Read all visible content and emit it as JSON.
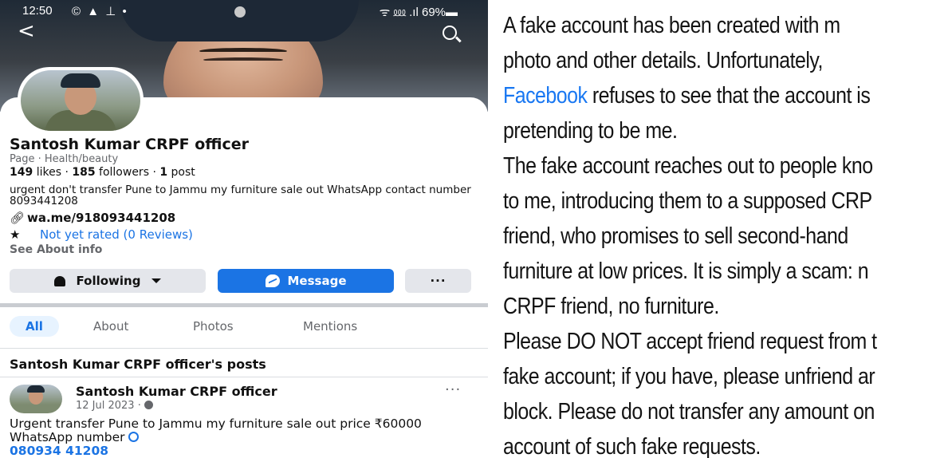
{
  "status_bar": {
    "time": "12:50",
    "left_icons": "© ▲ ⊥ •",
    "right": "ᯤ ⅏ .ıl 69%▬"
  },
  "nav": {
    "back_icon": "back-arrow",
    "search_icon": "search"
  },
  "profile": {
    "name": "Santosh Kumar CRPF officer",
    "category": "Page · Health/beauty",
    "likes": "149",
    "likes_label": "likes",
    "followers": "185",
    "followers_label": "followers",
    "posts": "1",
    "posts_label": "post",
    "sep": "·",
    "bio": "urgent don't transfer Pune to Jammu my furniture sale out WhatsApp contact number 8093441208",
    "link": "wa.me/918093441208",
    "rating": "Not yet rated (0 Reviews)",
    "about_info": "See About info"
  },
  "actions": {
    "following": "Following",
    "message": "Message",
    "more": "···"
  },
  "tabs": [
    "All",
    "About",
    "Photos",
    "Mentions"
  ],
  "posts_section": {
    "title": "Santosh Kumar CRPF officer's posts",
    "post": {
      "author": "Santosh Kumar CRPF officer",
      "date": "12 Jul 2023 ·",
      "more": "···",
      "text": "Urgent transfer Pune to Jammu my furniture sale out price ₹60000  WhatsApp number",
      "phone": "080934 41208"
    }
  },
  "notice": {
    "line1": "A fake account has been created with m",
    "line2": "photo and other details. Unfortunately,",
    "line3_link": "Facebook",
    "line3_rest": " refuses to see that the account is",
    "line4": "pretending to be me.",
    "line5": "The fake account reaches out to people kno",
    "line6": "to me, introducing them to a supposed CRP",
    "line7": "friend, who promises to sell second-hand",
    "line8": "furniture at low prices. It is simply a scam: n",
    "line9": "CRPF friend, no furniture.",
    "line10": "Please DO NOT accept friend request from t",
    "line11": "fake account; if you have, please unfriend ar",
    "line12": "block. Please do not transfer any amount on",
    "line13": "account of such fake requests."
  },
  "colors": {
    "accent": "#1b74e4",
    "link": "#1877f2",
    "text": "#111111",
    "muted": "#65676b"
  }
}
